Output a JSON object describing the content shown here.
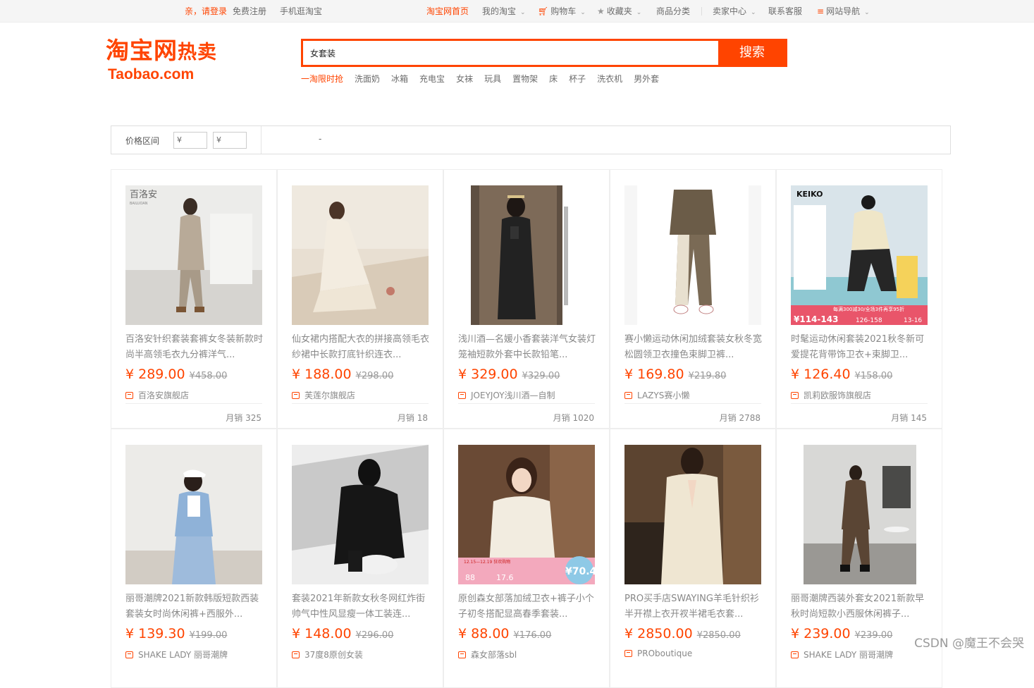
{
  "topbar": {
    "greeting": "亲，请登录",
    "register": "免费注册",
    "mobile": "手机逛淘宝",
    "home": "淘宝网首页",
    "my_taobao": "我的淘宝",
    "cart": "购物车",
    "favorites": "收藏夹",
    "categories": "商品分类",
    "seller_center": "卖家中心",
    "contact": "联系客服",
    "site_nav": "网站导航"
  },
  "logo": {
    "cn": "淘宝网",
    "hot": "热卖",
    "en": "Taobao.com"
  },
  "search": {
    "value": "女套装",
    "button": "搜索"
  },
  "hotwords": [
    "一淘限时抢",
    "洗面奶",
    "冰箱",
    "充电宝",
    "女袜",
    "玩具",
    "置物架",
    "床",
    "杯子",
    "洗衣机",
    "男外套"
  ],
  "filter": {
    "label": "价格区间",
    "min_placeholder": "¥",
    "max_placeholder": "¥",
    "dash": "-"
  },
  "products": [
    {
      "title": "百洛安针织套装套裤女冬装新款时尚半高领毛衣九分裤洋气...",
      "price": "¥ 289.00",
      "old_price": "¥458.00",
      "shop": "百洛安旗舰店",
      "sales": "月销 325"
    },
    {
      "title": "仙女裙内搭配大衣的拼接高领毛衣纱裙中长款打底针织连衣...",
      "price": "¥ 188.00",
      "old_price": "¥298.00",
      "shop": "芙莲尔旗舰店",
      "sales": "月销 18"
    },
    {
      "title": "浅川酒—名媛小香套装洋气女装灯笼袖短款外套中长款铅笔...",
      "price": "¥ 329.00",
      "old_price": "¥329.00",
      "shop": "JOEYJOY浅川酒—自制",
      "sales": "月销 1020"
    },
    {
      "title": "赛小懒运动休闲加绒套装女秋冬宽松圆领卫衣撞色束脚卫裤...",
      "price": "¥ 169.80",
      "old_price": "¥219.80",
      "shop": "LAZYS赛小懒",
      "sales": "月销 2788"
    },
    {
      "title": "时髦运动休闲套装2021秋冬新可爱提花背带饰卫衣+束脚卫...",
      "price": "¥ 126.40",
      "old_price": "¥158.00",
      "shop": "凯莉欧服饰旗舰店",
      "sales": "月销 145"
    },
    {
      "title": "丽哥潮牌2021新款韩版短款西装套装女时尚休闲裤+西服外...",
      "price": "¥ 139.30",
      "old_price": "¥199.00",
      "shop": "SHAKE LADY 丽哥潮牌",
      "sales": ""
    },
    {
      "title": "套装2021年新款女秋冬网红炸街帅气中性风显瘦一体工装连...",
      "price": "¥ 148.00",
      "old_price": "¥296.00",
      "shop": "37度8原创女装",
      "sales": ""
    },
    {
      "title": "原创森女部落加绒卫衣+裤子小个子初冬搭配显高春季套装...",
      "price": "¥ 88.00",
      "old_price": "¥176.00",
      "shop": "森女部落sbl",
      "sales": ""
    },
    {
      "title": "PRO买手店SWAYING羊毛针织衫半开襟上衣开衩半裙毛衣套...",
      "price": "¥ 2850.00",
      "old_price": "¥2850.00",
      "shop": "PROboutique",
      "sales": ""
    },
    {
      "title": "丽哥潮牌西装外套女2021新款早秋时尚短款小西服休闲裤子...",
      "price": "¥ 239.00",
      "old_price": "¥239.00",
      "shop": "SHAKE LADY 丽哥潮牌",
      "sales": ""
    }
  ],
  "image_texts": {
    "p1_brand": "百洛安",
    "p1_brand_en": "BAILUOAN",
    "p5_brand": "KEIKO",
    "p5_promo": "每满300减30/全场3件再享95折",
    "p5_price": "¥114-143",
    "p5_range_a": "126-158",
    "p5_range_b": "13-16",
    "p8_badge": "12.15—12.19 狂欢购物",
    "p8_price": "¥70.4",
    "p8_strike": "88",
    "p8_strike2": "17.6"
  },
  "watermark": "CSDN @魔王不会哭",
  "colors": {
    "accent": "#ff4400"
  }
}
